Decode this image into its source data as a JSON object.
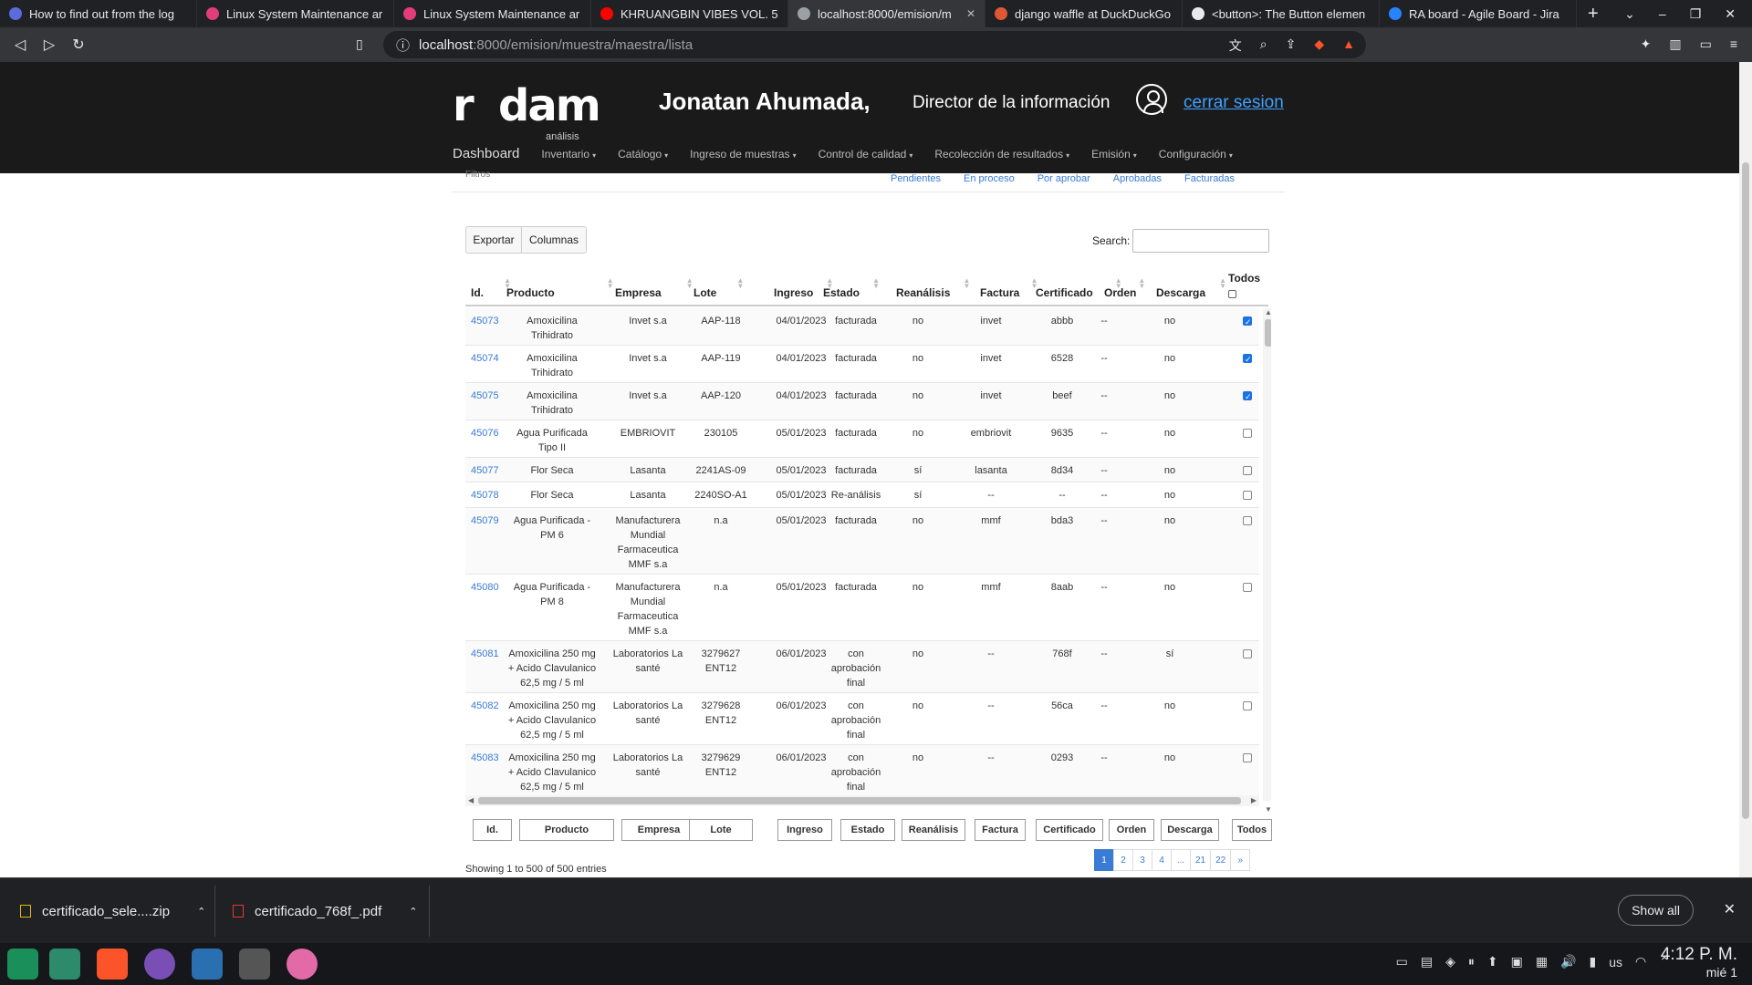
{
  "browser": {
    "tabs": [
      {
        "title": "How to find out from the log",
        "color": "#5b6bdb",
        "active": false
      },
      {
        "title": "Linux System Maintenance ar",
        "color": "#e23c7a",
        "active": false
      },
      {
        "title": "Linux System Maintenance ar",
        "color": "#e23c7a",
        "active": false
      },
      {
        "title": "KHRUANGBIN VIBES VOL. 5 -",
        "color": "#ff0000",
        "active": false
      },
      {
        "title": "localhost:8000/emision/m",
        "color": "#9aa0a6",
        "active": true
      },
      {
        "title": "django waffle at DuckDuckGo",
        "color": "#de5833",
        "active": false
      },
      {
        "title": "<button>: The Button elemen",
        "color": "#e8eaed",
        "active": false
      },
      {
        "title": "RA board - Agile Board - Jira",
        "color": "#2684ff",
        "active": false
      }
    ],
    "url_host": "localhost",
    "url_rest": ":8000/emision/muestra/maestra/lista"
  },
  "header": {
    "logo_text": "dam",
    "logo_r": "r",
    "logo_sub": "análisis",
    "user_name": "Jonatan Ahumada,",
    "user_role": "Director de la información",
    "logout": "cerrar sesion"
  },
  "nav": {
    "home": "Dashboard",
    "items": [
      "Inventario",
      "Catálogo",
      "Ingreso de muestras",
      "Control de calidad",
      "Recolección de resultados",
      "Emisión",
      "Configuración"
    ]
  },
  "status_links": [
    "Pendientes",
    "En proceso",
    "Por aprobar",
    "Aprobadas",
    "Facturadas"
  ],
  "filter_cut": "Filtros",
  "toolbar": {
    "export": "Exportar",
    "columns": "Columnas",
    "search_label": "Search:",
    "search_value": ""
  },
  "columns": [
    "Id.",
    "Producto",
    "Empresa",
    "Lote",
    "Ingreso",
    "Estado",
    "Reanálisis",
    "Factura",
    "Certificado",
    "Orden",
    "Descarga",
    "Todos"
  ],
  "rows": [
    {
      "id": "45073",
      "producto": "Amoxicilina Trihidrato",
      "empresa": "Invet s.a",
      "lote": "AAP-118",
      "ingreso": "04/01/2023",
      "estado": "facturada",
      "reanalisis": "no",
      "factura": "invet",
      "certificado": "abbb",
      "orden": "--",
      "descarga": "no",
      "checked": true
    },
    {
      "id": "45074",
      "producto": "Amoxicilina Trihidrato",
      "empresa": "Invet s.a",
      "lote": "AAP-119",
      "ingreso": "04/01/2023",
      "estado": "facturada",
      "reanalisis": "no",
      "factura": "invet",
      "certificado": "6528",
      "orden": "--",
      "descarga": "no",
      "checked": true
    },
    {
      "id": "45075",
      "producto": "Amoxicilina Trihidrato",
      "empresa": "Invet s.a",
      "lote": "AAP-120",
      "ingreso": "04/01/2023",
      "estado": "facturada",
      "reanalisis": "no",
      "factura": "invet",
      "certificado": "beef",
      "orden": "--",
      "descarga": "no",
      "checked": true
    },
    {
      "id": "45076",
      "producto": "Agua Purificada Tipo II",
      "empresa": "EMBRIOVIT",
      "lote": "230105",
      "ingreso": "05/01/2023",
      "estado": "facturada",
      "reanalisis": "no",
      "factura": "embriovit",
      "certificado": "9635",
      "orden": "--",
      "descarga": "no",
      "checked": false
    },
    {
      "id": "45077",
      "producto": "Flor Seca",
      "empresa": "Lasanta",
      "lote": "2241AS-09",
      "ingreso": "05/01/2023",
      "estado": "facturada",
      "reanalisis": "sí",
      "factura": "lasanta",
      "certificado": "8d34",
      "orden": "--",
      "descarga": "no",
      "checked": false
    },
    {
      "id": "45078",
      "producto": "Flor Seca",
      "empresa": "Lasanta",
      "lote": "2240SO-A1",
      "ingreso": "05/01/2023",
      "estado": "Re-análisis",
      "reanalisis": "sí",
      "factura": "--",
      "certificado": "--",
      "orden": "--",
      "descarga": "no",
      "checked": false
    },
    {
      "id": "45079",
      "producto": "Agua Purificada - PM 6",
      "empresa": "Manufacturera Mundial Farmaceutica MMF s.a",
      "lote": "n.a",
      "ingreso": "05/01/2023",
      "estado": "facturada",
      "reanalisis": "no",
      "factura": "mmf",
      "certificado": "bda3",
      "orden": "--",
      "descarga": "no",
      "checked": false
    },
    {
      "id": "45080",
      "producto": "Agua Purificada - PM 8",
      "empresa": "Manufacturera Mundial Farmaceutica MMF s.a",
      "lote": "n.a",
      "ingreso": "05/01/2023",
      "estado": "facturada",
      "reanalisis": "no",
      "factura": "mmf",
      "certificado": "8aab",
      "orden": "--",
      "descarga": "no",
      "checked": false
    },
    {
      "id": "45081",
      "producto": "Amoxicilina 250 mg + Acido Clavulanico 62,5 mg / 5 ml",
      "empresa": "Laboratorios La santé",
      "lote": "3279627 ENT12",
      "ingreso": "06/01/2023",
      "estado": "con aprobación final",
      "reanalisis": "no",
      "factura": "--",
      "certificado": "768f",
      "orden": "--",
      "descarga": "sí",
      "checked": false
    },
    {
      "id": "45082",
      "producto": "Amoxicilina 250 mg + Acido Clavulanico 62,5 mg / 5 ml",
      "empresa": "Laboratorios La santé",
      "lote": "3279628 ENT12",
      "ingreso": "06/01/2023",
      "estado": "con aprobación final",
      "reanalisis": "no",
      "factura": "--",
      "certificado": "56ca",
      "orden": "--",
      "descarga": "no",
      "checked": false
    },
    {
      "id": "45083",
      "producto": "Amoxicilina 250 mg + Acido Clavulanico 62,5 mg / 5 ml",
      "empresa": "Laboratorios La santé",
      "lote": "3279629 ENT12",
      "ingreso": "06/01/2023",
      "estado": "con aprobación final",
      "reanalisis": "no",
      "factura": "--",
      "certificado": "0293",
      "orden": "--",
      "descarga": "no",
      "checked": false
    }
  ],
  "footer": {
    "info": "Showing 1 to 500 of 500 entries",
    "pages": [
      "1",
      "2",
      "3",
      "4",
      "...",
      "21",
      "22",
      "»"
    ],
    "active_page": "1"
  },
  "downloads": {
    "items": [
      "certificado_sele....zip",
      "certificado_768f_.pdf"
    ],
    "show_all": "Show all"
  },
  "taskbar": {
    "keyboard": "us",
    "time": "4:12 P. M.",
    "date": "mié 1"
  },
  "colors": {
    "link": "#3a7bd5",
    "header_bg": "#1a1a1a",
    "logout": "#3fa0ff"
  }
}
